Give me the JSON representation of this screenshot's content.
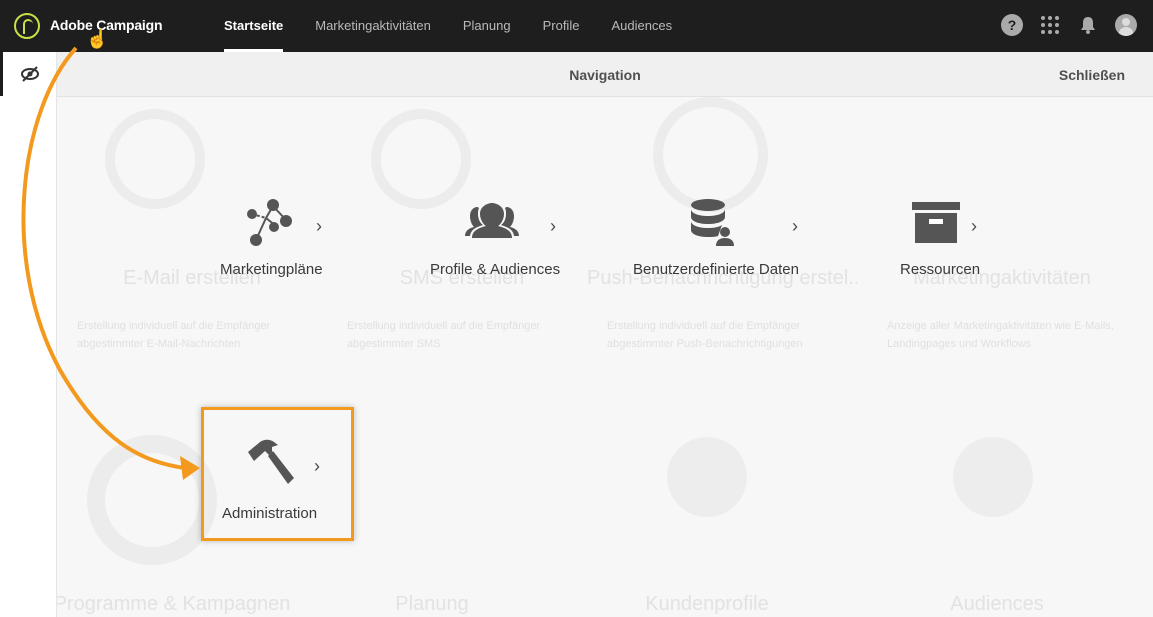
{
  "app": {
    "name": "Adobe Campaign"
  },
  "topnav": {
    "items": [
      {
        "label": "Startseite",
        "active": true
      },
      {
        "label": "Marketingaktivitäten",
        "active": false
      },
      {
        "label": "Planung",
        "active": false
      },
      {
        "label": "Profile",
        "active": false
      },
      {
        "label": "Audiences",
        "active": false
      }
    ],
    "help_symbol": "?"
  },
  "panel": {
    "title": "Navigation",
    "close_label": "Schließen"
  },
  "tiles": [
    {
      "label": "Marketingpläne",
      "icon": "network-icon",
      "chevron": "›"
    },
    {
      "label": "Profile & Audiences",
      "icon": "people-icon",
      "chevron": "›"
    },
    {
      "label": "Benutzerdefinierte Daten",
      "icon": "database-user-icon",
      "chevron": "›"
    },
    {
      "label": "Ressourcen",
      "icon": "archive-box-icon",
      "chevron": "›"
    },
    {
      "label": "Administration",
      "icon": "hammer-icon",
      "chevron": "›",
      "highlighted": true
    }
  ],
  "background_cards": [
    {
      "title": "E-Mail erstellen",
      "desc": "Erstellung individuell auf die Empfänger abgestimmter E-Mail-Nachrichten"
    },
    {
      "title": "SMS erstellen",
      "desc": "Erstellung individuell auf die Empfänger abgestimmter SMS"
    },
    {
      "title": "Push-Benachrichtigung erstel...",
      "desc": "Erstellung individuell auf die Empfänger abgestimmter Push-Benachrichtigungen"
    },
    {
      "title": "Marketingaktivitäten",
      "desc": "Anzeige aller Marketingaktivitäten wie E-Mails, Landingpages und Workflows"
    },
    {
      "title": "Programme & Kampagnen",
      "desc": ""
    },
    {
      "title": "Planung",
      "desc": ""
    },
    {
      "title": "Kundenprofile",
      "desc": ""
    },
    {
      "title": "Audiences",
      "desc": ""
    }
  ],
  "colors": {
    "topbar": "#1e1e1e",
    "logo_accent": "#c7e14b",
    "highlight": "#f39a1e",
    "icon": "#555555"
  }
}
